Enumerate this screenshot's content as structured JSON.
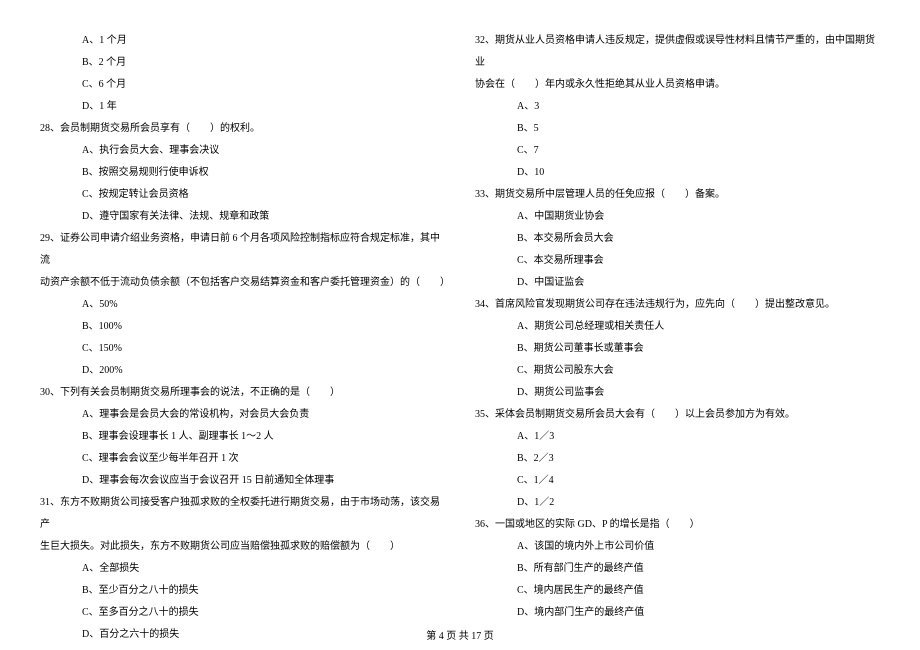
{
  "left_column": {
    "q27_options": {
      "a": "A、1 个月",
      "b": "B、2 个月",
      "c": "C、6 个月",
      "d": "D、1 年"
    },
    "q28": {
      "text": "28、会员制期货交易所会员享有（　　）的权利。",
      "a": "A、执行会员大会、理事会决议",
      "b": "B、按照交易规则行使申诉权",
      "c": "C、按规定转让会员资格",
      "d": "D、遵守国家有关法律、法规、规章和政策"
    },
    "q29": {
      "line1": "29、证券公司申请介绍业务资格，申请日前 6 个月各项风险控制指标应符合规定标准，其中流",
      "line2": "动资产余额不低于流动负债余额（不包括客户交易结算资金和客户委托管理资金）的（　　）",
      "a": "A、50%",
      "b": "B、100%",
      "c": "C、150%",
      "d": "D、200%"
    },
    "q30": {
      "text": "30、下列有关会员制期货交易所理事会的说法，不正确的是（　　）",
      "a": "A、理事会是会员大会的常设机构，对会员大会负责",
      "b": "B、理事会设理事长 1 人、副理事长 1～2 人",
      "c": "C、理事会会议至少每半年召开 1 次",
      "d": "D、理事会每次会议应当于会议召开 15 日前通知全体理事"
    },
    "q31": {
      "line1": "31、东方不败期货公司接受客户独孤求败的全权委托进行期货交易，由于市场动荡，该交易产",
      "line2": "生巨大损失。对此损失，东方不败期货公司应当赔偿独孤求败的赔偿额为（　　）",
      "a": "A、全部损失",
      "b": "B、至少百分之八十的损失",
      "c": "C、至多百分之八十的损失",
      "d": "D、百分之六十的损失"
    }
  },
  "right_column": {
    "q32": {
      "line1": "32、期货从业人员资格申请人违反规定，提供虚假或误导性材料且情节严重的，由中国期货业",
      "line2": "协会在（　　）年内或永久性拒绝其从业人员资格申请。",
      "a": "A、3",
      "b": "B、5",
      "c": "C、7",
      "d": "D、10"
    },
    "q33": {
      "text": "33、期货交易所中层管理人员的任免应报（　　）备案。",
      "a": "A、中国期货业协会",
      "b": "B、本交易所会员大会",
      "c": "C、本交易所理事会",
      "d": "D、中国证监会"
    },
    "q34": {
      "text": "34、首席风险官发现期货公司存在违法违规行为，应先向（　　）提出整改意见。",
      "a": "A、期货公司总经理或相关责任人",
      "b": "B、期货公司董事长或董事会",
      "c": "C、期货公司股东大会",
      "d": "D、期货公司监事会"
    },
    "q35": {
      "text": "35、采体会员制期货交易所会员大会有（　　）以上会员参加方为有效。",
      "a": "A、1／3",
      "b": "B、2／3",
      "c": "C、1／4",
      "d": "D、1／2"
    },
    "q36": {
      "text": "36、一国或地区的实际 GD、P 的增长是指（　　）",
      "a": "A、该国的境内外上市公司价值",
      "b": "B、所有部门生产的最终产值",
      "c": "C、境内居民生产的最终产值",
      "d": "D、境内部门生产的最终产值"
    }
  },
  "footer": "第 4 页 共 17 页"
}
